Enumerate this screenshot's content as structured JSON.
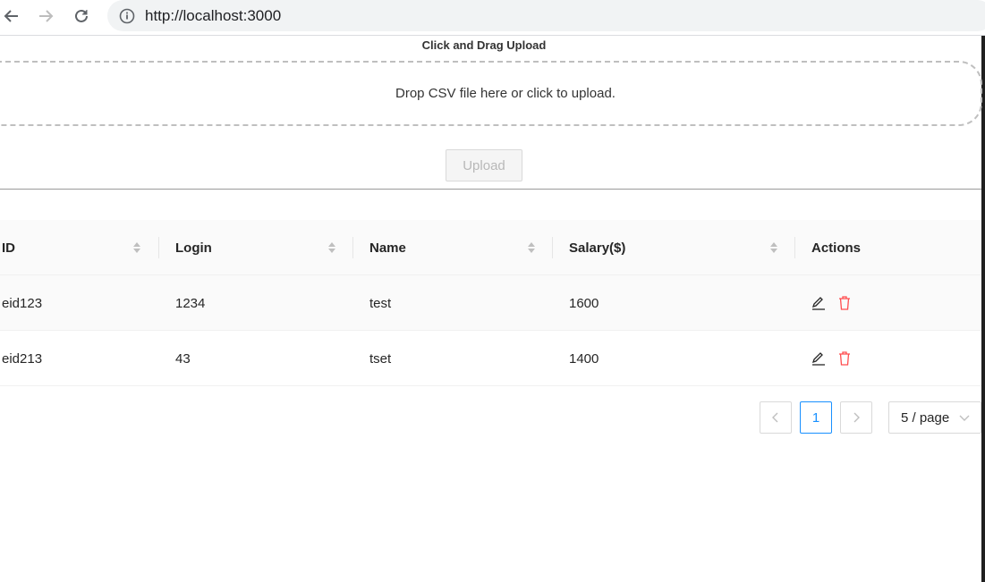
{
  "browser": {
    "url": "http://localhost:3000"
  },
  "upload": {
    "title": "Click and Drag Upload",
    "dropzone_text": "Drop CSV file here or click to upload.",
    "button_label": "Upload"
  },
  "table": {
    "columns": [
      "ID",
      "Login",
      "Name",
      "Salary($)",
      "Actions"
    ],
    "rows": [
      {
        "id": "eid123",
        "login": "1234",
        "name": "test",
        "salary": "1600"
      },
      {
        "id": "eid213",
        "login": "43",
        "name": "tset",
        "salary": "1400"
      }
    ],
    "icons": {
      "edit": "edit-icon",
      "delete": "delete-icon"
    }
  },
  "pagination": {
    "current_page": "1",
    "page_size_label": "5 / page"
  },
  "colors": {
    "accent": "#1890ff",
    "danger": "#ff4d4f"
  }
}
